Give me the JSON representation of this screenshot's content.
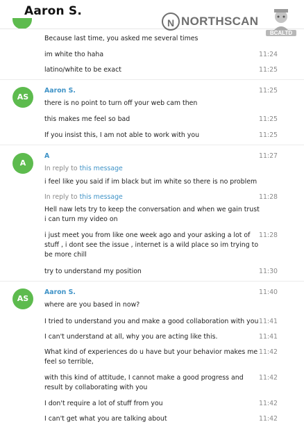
{
  "header": {
    "title": "Aaron S."
  },
  "watermark": {
    "logo_glyph": "N",
    "text": "NORTHSCAN",
    "badge": "BCALTD"
  },
  "colors": {
    "avatar": "#5dbb4e",
    "sender": "#3f93c7",
    "time": "#888888"
  },
  "messages": [
    {
      "text": "Because last time, you asked me several times",
      "time": ""
    },
    {
      "text": "im white tho haha",
      "time": "11:24"
    },
    {
      "text": "latino/white to be exact",
      "time": "11:25"
    },
    {
      "sender": "Aaron S.",
      "avatar": "AS",
      "time": "11:25"
    },
    {
      "text": "there is no point to turn off your web cam then",
      "time": ""
    },
    {
      "text": "this makes me feel so bad",
      "time": "11:25"
    },
    {
      "text": "If you insist this, I am not able to work with you",
      "time": "11:25"
    },
    {
      "sender": "A",
      "avatar": "A",
      "time": "11:27"
    },
    {
      "reply_prefix": "In reply to",
      "reply_link": "this message"
    },
    {
      "text": "i feel like you said if im black but im white so there is no problem",
      "time": ""
    },
    {
      "reply_prefix": "In reply to",
      "reply_link": "this message",
      "time": "11:28"
    },
    {
      "text": "Hell naw lets try to keep the conversation and when we gain trust i can turn my video on",
      "time": ""
    },
    {
      "text": "i just meet you from like one week ago and your asking a lot of stuff , i dont see the issue , internet is a wild place so im trying to be more chill",
      "time": "11:28"
    },
    {
      "text": "try to understand my position",
      "time": "11:30"
    },
    {
      "sender": "Aaron S.",
      "avatar": "AS",
      "time": "11:40"
    },
    {
      "text": "where are you based in now?",
      "time": ""
    },
    {
      "text": "I tried to understand you and make a good collaboration with you",
      "time": "11:41"
    },
    {
      "text": "I can't understand at all, why you are acting like this.",
      "time": "11:41"
    },
    {
      "text": "What kind of experiences do u have but your behavior makes me feel so terrible,",
      "time": "11:42"
    },
    {
      "text": "with this kind of attitude, I cannot make a good progress and result by collaborating with you",
      "time": "11:42"
    },
    {
      "text": "I don't require a lot of stuff from you",
      "time": "11:42"
    },
    {
      "text": "I can't get what you are talking about",
      "time": "11:42"
    }
  ]
}
